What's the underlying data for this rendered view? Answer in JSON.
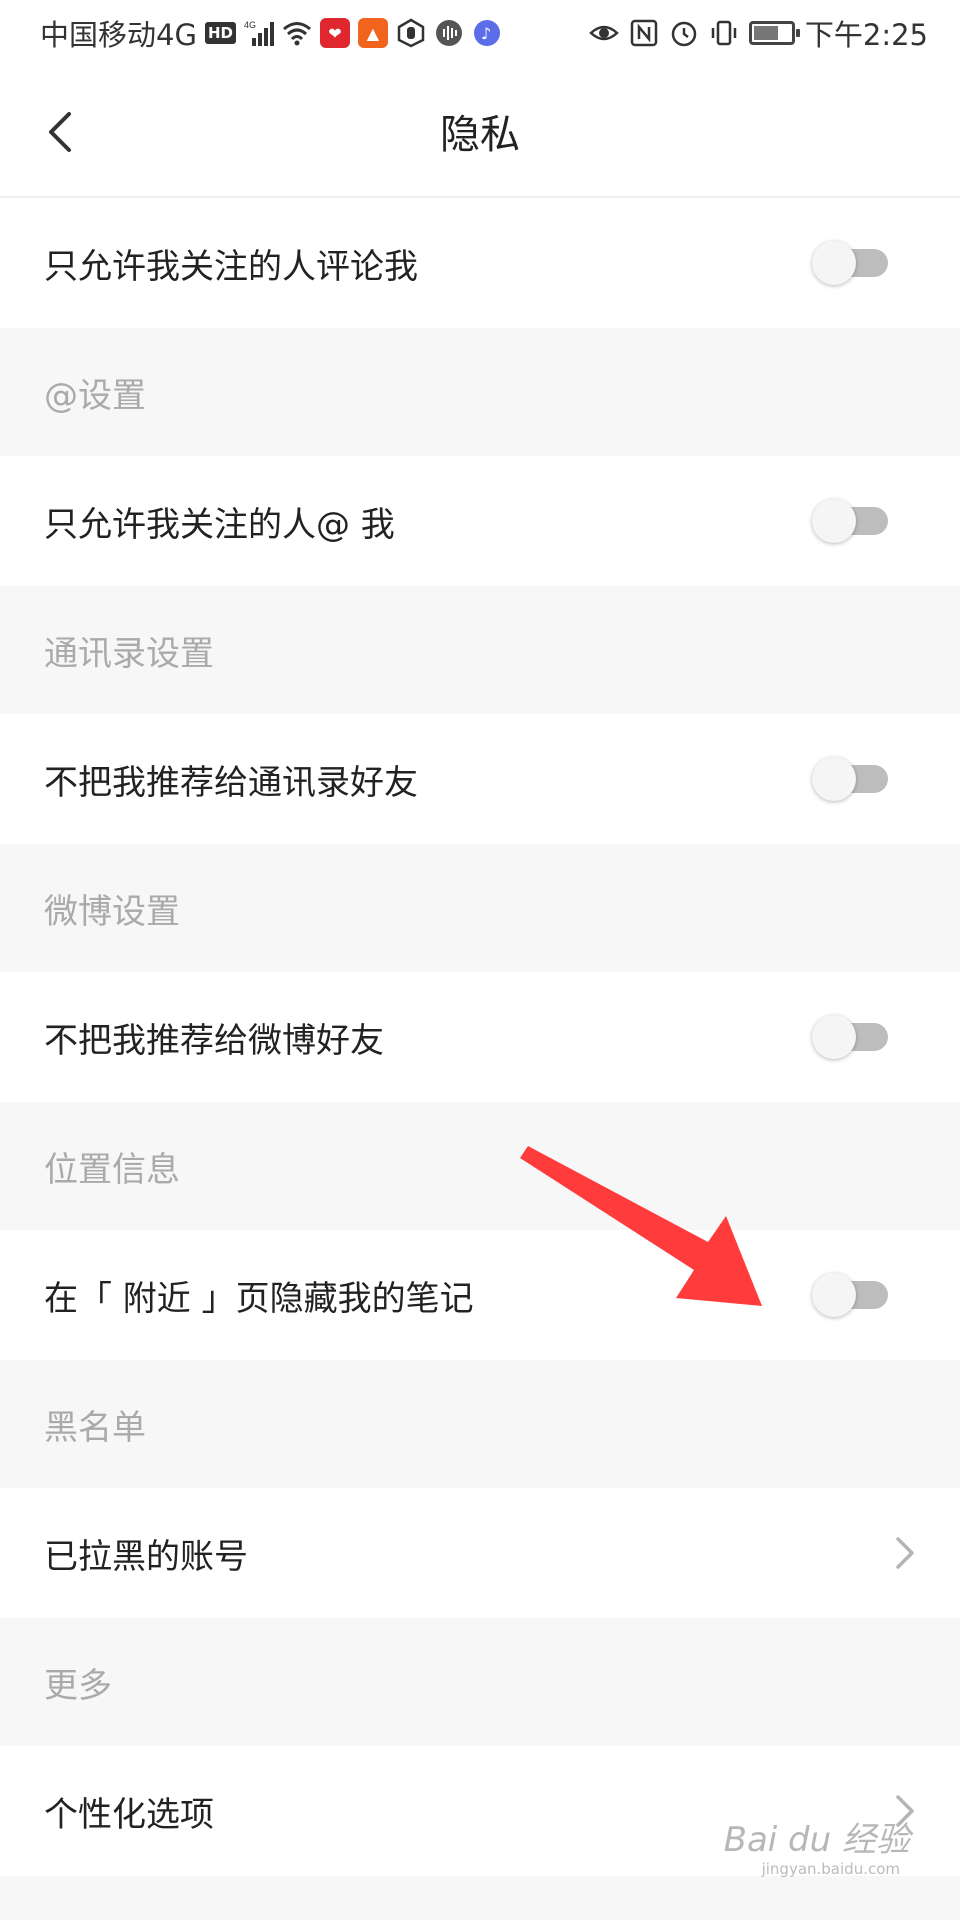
{
  "status_bar": {
    "carrier": "中国移动4G",
    "hd_badge": "HD",
    "signal_label": "4G",
    "time": "下午2:25"
  },
  "nav": {
    "title": "隐私"
  },
  "rows": {
    "comment_only_following": {
      "label": "只允许我关注的人评论我",
      "toggle_on": false
    },
    "at_only_following": {
      "label": "只允许我关注的人@ 我",
      "toggle_on": false
    },
    "no_recommend_contacts": {
      "label": "不把我推荐给通讯录好友",
      "toggle_on": false
    },
    "no_recommend_weibo": {
      "label": "不把我推荐给微博好友",
      "toggle_on": false
    },
    "hide_nearby_notes": {
      "label": "在「 附近 」页隐藏我的笔记",
      "toggle_on": false
    },
    "blocked_accounts": {
      "label": "已拉黑的账号"
    },
    "personalization": {
      "label": "个性化选项"
    }
  },
  "sections": {
    "at_settings": "@设置",
    "contacts_settings": "通讯录设置",
    "weibo_settings": "微博设置",
    "location_info": "位置信息",
    "blacklist": "黑名单",
    "more": "更多"
  },
  "watermark": {
    "brand": "Bai du 经验",
    "url": "jingyan.baidu.com"
  },
  "colors": {
    "background": "#f7f7f7",
    "row_background": "#ffffff",
    "section_text": "#aaaaaa",
    "toggle_track_off": "#bdbdbd",
    "annotation_arrow": "#ff3b3b"
  }
}
